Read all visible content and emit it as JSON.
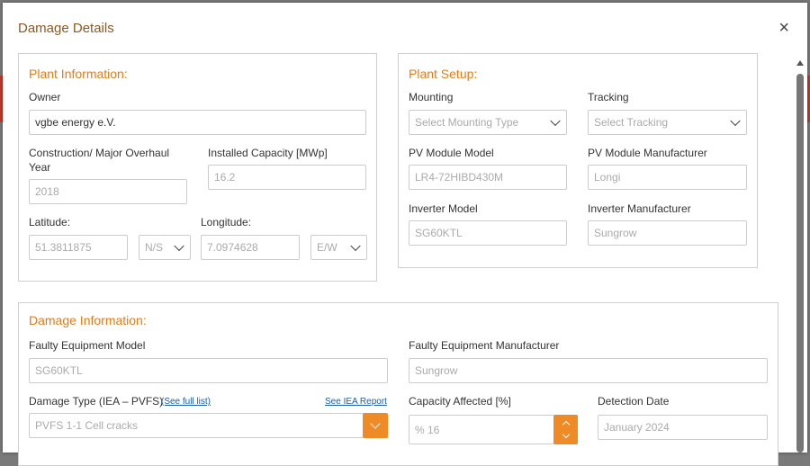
{
  "modal": {
    "title": "Damage Details",
    "close_glyph": "×"
  },
  "plant_info": {
    "title": "Plant Information:",
    "owner_label": "Owner",
    "owner_value": "vgbe energy e.V.",
    "construction_label_1": "Construction/ Major Overhaul",
    "construction_label_2": "Year",
    "construction_value": "2018",
    "capacity_label": "Installed Capacity [MWp]",
    "capacity_value": "16.2",
    "latitude_label": "Latitude:",
    "latitude_value": "51.3811875",
    "ns_value": "N/S",
    "longitude_label": "Longitude:",
    "longitude_value": "7.0974628",
    "ew_value": "E/W"
  },
  "plant_setup": {
    "title": "Plant Setup:",
    "mounting_label": "Mounting",
    "mounting_placeholder": "Select Mounting Type",
    "tracking_label": "Tracking",
    "tracking_placeholder": "Select Tracking",
    "module_model_label": "PV Module Model",
    "module_model_value": "LR4-72HIBD430M",
    "module_manufacturer_label": "PV Module Manufacturer",
    "module_manufacturer_value": "Longi",
    "inverter_model_label": "Inverter Model",
    "inverter_model_value": "SG60KTL",
    "inverter_manufacturer_label": "Inverter Manufacturer",
    "inverter_manufacturer_value": "Sungrow"
  },
  "damage_info": {
    "title": "Damage Information:",
    "faulty_model_label": "Faulty Equipment Model",
    "faulty_model_value": "SG60KTL",
    "faulty_manufacturer_label": "Faulty Equipment Manufacturer",
    "faulty_manufacturer_value": "Sungrow",
    "damage_type_label": "Damage Type (IEA – PVFS)",
    "full_list_link": "(See full list)",
    "iea_report_link": "See IEA Report",
    "damage_type_value": "PVFS 1-1  Cell cracks",
    "capacity_affected_label": "Capacity Affected [%]",
    "capacity_affected_value": "% 16",
    "detection_date_label": "Detection Date",
    "detection_date_value": "January 2024"
  },
  "colors": {
    "accent": "#e07d1a",
    "title": "#8a5a1f",
    "link": "#1a5ea8",
    "button": "#ef8b26"
  },
  "icons": [
    "close-icon",
    "chevron-down-icon",
    "spinner-up-icon",
    "spinner-down-icon"
  ]
}
